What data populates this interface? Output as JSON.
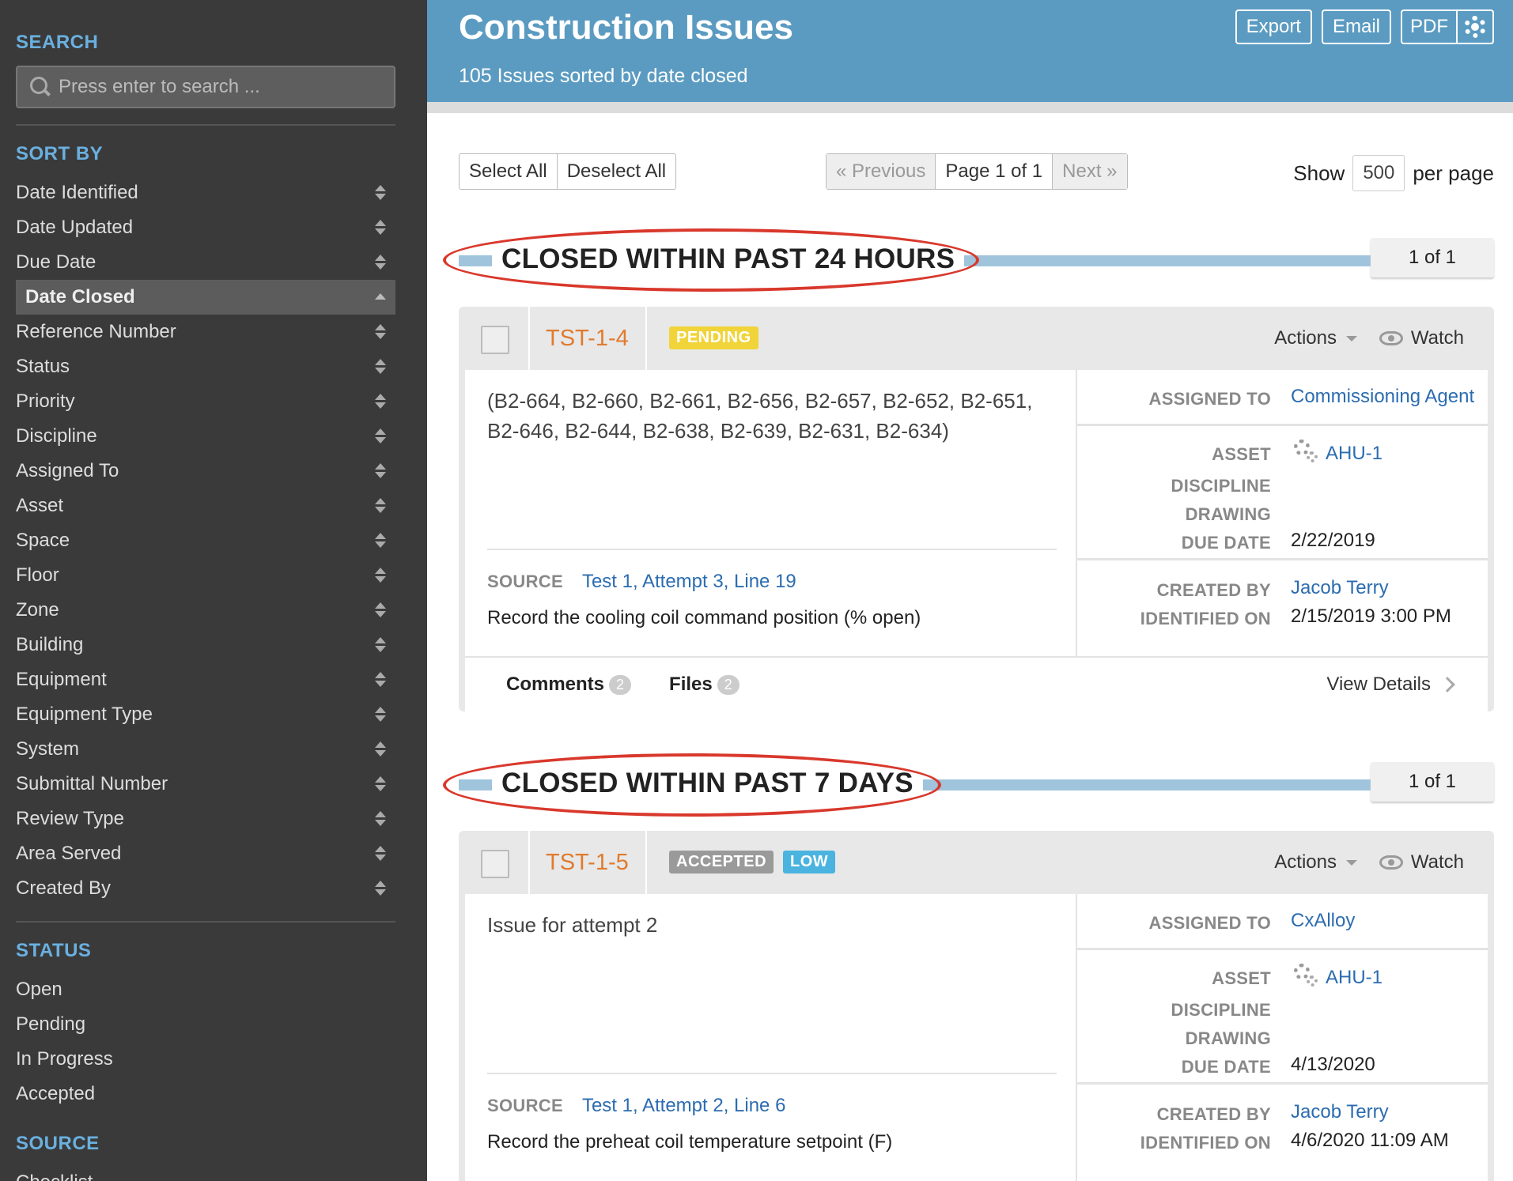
{
  "sidebar": {
    "search_heading": "SEARCH",
    "search_placeholder": "Press enter to search ...",
    "sortby_heading": "SORT BY",
    "sort_items": [
      {
        "label": "Date Identified"
      },
      {
        "label": "Date Updated"
      },
      {
        "label": "Due Date"
      },
      {
        "label": "Date Closed",
        "active": true
      },
      {
        "label": "Reference Number"
      },
      {
        "label": "Status"
      },
      {
        "label": "Priority"
      },
      {
        "label": "Discipline"
      },
      {
        "label": "Assigned To"
      },
      {
        "label": "Asset"
      },
      {
        "label": "Space"
      },
      {
        "label": "Floor"
      },
      {
        "label": "Zone"
      },
      {
        "label": "Building"
      },
      {
        "label": "Equipment"
      },
      {
        "label": "Equipment Type"
      },
      {
        "label": "System"
      },
      {
        "label": "Submittal Number"
      },
      {
        "label": "Review Type"
      },
      {
        "label": "Area Served"
      },
      {
        "label": "Created By"
      }
    ],
    "status_heading": "STATUS",
    "status_items": [
      "Open",
      "Pending",
      "In Progress",
      "Accepted"
    ],
    "source_heading": "SOURCE",
    "source_items": [
      "Checklist"
    ]
  },
  "header": {
    "title": "Construction Issues",
    "subtitle": "105 Issues sorted by date closed",
    "export_label": "Export",
    "email_label": "Email",
    "pdf_label": "PDF"
  },
  "toolbar": {
    "select_all": "Select All",
    "deselect_all": "Deselect All",
    "previous": "« Previous",
    "page": "Page 1 of 1",
    "next": "Next »",
    "show_label": "Show",
    "per_page_value": "500",
    "per_page_label": "per page"
  },
  "groups": [
    {
      "title": "CLOSED WITHIN PAST 24 HOURS",
      "counter": "1 of 1",
      "issue": {
        "id": "TST-1-4",
        "badges": [
          {
            "text": "PENDING",
            "color": "#f0d43a"
          }
        ],
        "actions": "Actions",
        "watch": "Watch",
        "description": "(B2-664, B2-660, B2-661, B2-656, B2-657, B2-652, B2-651, B2-646, B2-644, B2-638, B2-639, B2-631, B2-634)",
        "source_label": "SOURCE",
        "source_link": "Test 1, Attempt 3, Line 19",
        "source_text": "Record the cooling coil command position (% open)",
        "assigned_to_label": "ASSIGNED TO",
        "assigned_to": "Commissioning Agent",
        "asset_label": "ASSET",
        "asset": "AHU-1",
        "discipline_label": "DISCIPLINE",
        "drawing_label": "DRAWING",
        "due_date_label": "DUE DATE",
        "due_date": "2/22/2019",
        "created_by_label": "CREATED BY",
        "created_by": "Jacob Terry",
        "identified_on_label": "IDENTIFIED ON",
        "identified_on": "2/15/2019 3:00 PM",
        "comments_label": "Comments",
        "comments_count": "2",
        "files_label": "Files",
        "files_count": "2",
        "view_details": "View Details"
      }
    },
    {
      "title": "CLOSED WITHIN PAST 7 DAYS",
      "counter": "1 of 1",
      "issue": {
        "id": "TST-1-5",
        "badges": [
          {
            "text": "ACCEPTED",
            "color": "#9a9a9a"
          },
          {
            "text": "LOW",
            "color": "#4ab3df"
          }
        ],
        "actions": "Actions",
        "watch": "Watch",
        "description": "Issue for attempt 2",
        "source_label": "SOURCE",
        "source_link": "Test 1, Attempt 2, Line 6",
        "source_text": "Record the preheat coil temperature setpoint (F)",
        "assigned_to_label": "ASSIGNED TO",
        "assigned_to": "CxAlloy",
        "asset_label": "ASSET",
        "asset": "AHU-1",
        "discipline_label": "DISCIPLINE",
        "drawing_label": "DRAWING",
        "due_date_label": "DUE DATE",
        "due_date": "4/13/2020",
        "created_by_label": "CREATED BY",
        "created_by": "Jacob Terry",
        "identified_on_label": "IDENTIFIED ON",
        "identified_on": "4/6/2020 11:09 AM"
      }
    }
  ],
  "colors": {
    "sidebar_bg": "#3a3a3a",
    "sidebar_heading": "#6ab0e0",
    "header_bg": "#5b9bc1",
    "issue_id": "#e07b2e",
    "link": "#2b6cb0",
    "annotation_circle": "#d9382c"
  }
}
